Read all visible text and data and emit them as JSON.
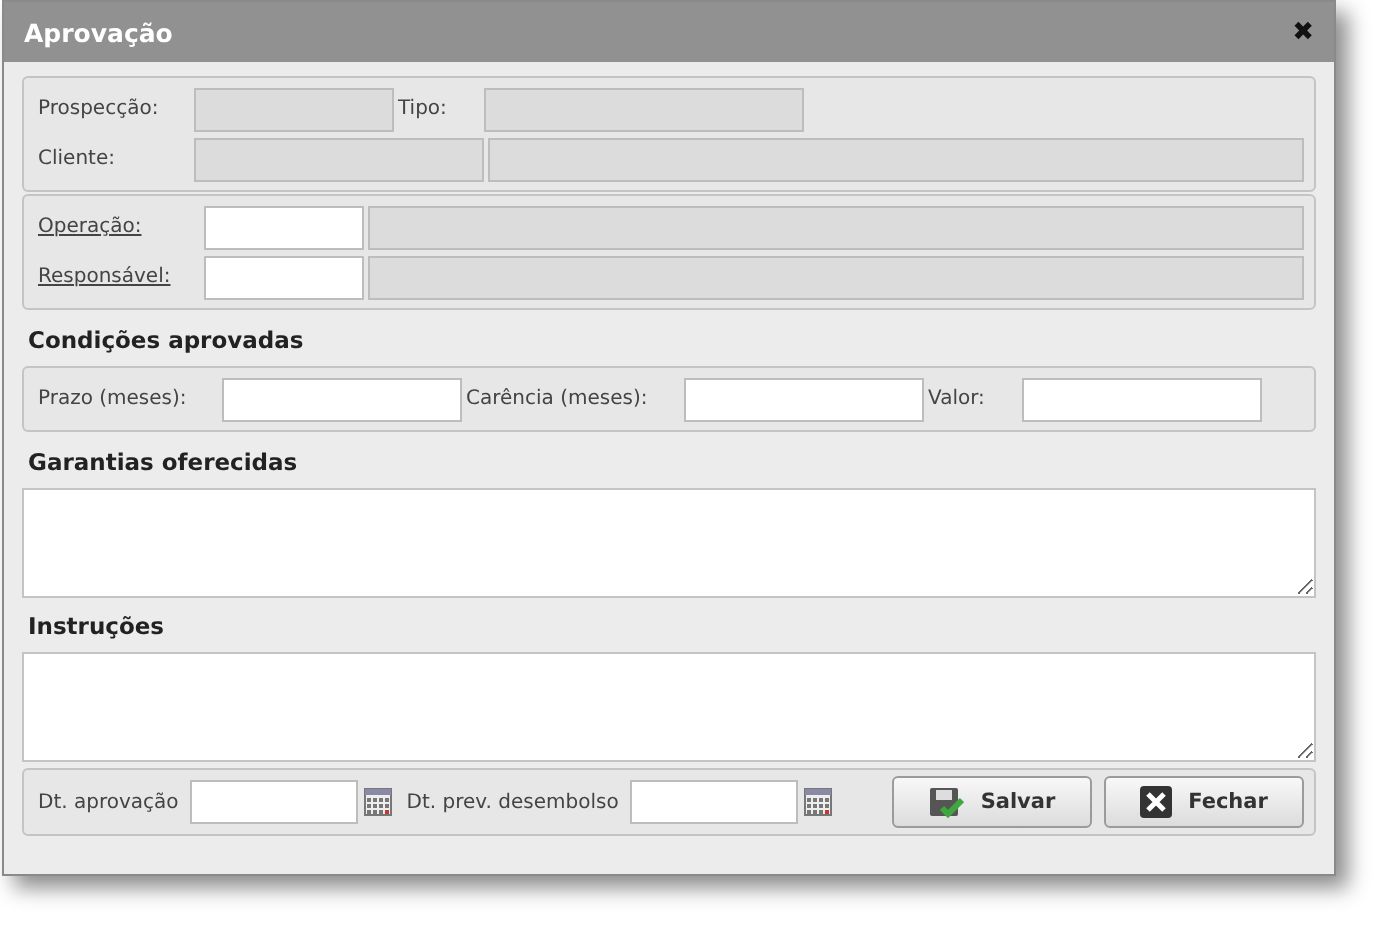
{
  "window": {
    "title": "Aprovação",
    "close": "✖"
  },
  "identification": {
    "rows": [
      {
        "items": [
          {
            "kind": "label",
            "text": "Prospecção:",
            "underlined": false
          },
          {
            "kind": "field",
            "readonly": true
          },
          {
            "kind": "label",
            "text": "Tipo:",
            "underlined": false
          },
          {
            "kind": "field",
            "readonly": true
          }
        ]
      },
      {
        "items": [
          {
            "kind": "label",
            "text": "Cliente:",
            "underlined": false
          },
          {
            "kind": "field",
            "readonly": true
          },
          {
            "kind": "field",
            "readonly": true
          }
        ]
      }
    ]
  },
  "assignment": {
    "rows": [
      {
        "items": [
          {
            "kind": "label",
            "text": "Operação:",
            "underlined": true
          },
          {
            "kind": "field",
            "readonly": false
          },
          {
            "kind": "field",
            "readonly": true
          }
        ]
      },
      {
        "items": [
          {
            "kind": "label",
            "text": "Responsável:",
            "underlined": true
          },
          {
            "kind": "field",
            "readonly": false
          },
          {
            "kind": "field",
            "readonly": true
          }
        ]
      }
    ]
  },
  "conditions": {
    "title": "Condições aprovadas",
    "rows": [
      {
        "items": [
          {
            "kind": "label",
            "text": "Prazo (meses):",
            "underlined": false
          },
          {
            "kind": "field",
            "readonly": false
          },
          {
            "kind": "label",
            "text": "Carência (meses):",
            "underlined": false
          },
          {
            "kind": "field",
            "readonly": false
          },
          {
            "kind": "label",
            "text": "Valor:",
            "underlined": false
          },
          {
            "kind": "field",
            "readonly": false
          }
        ]
      }
    ]
  },
  "guarantees": {
    "title": "Garantias oferecidas"
  },
  "instructions": {
    "title": "Instruções"
  },
  "footer": {
    "dates": [
      {
        "label": "Dt. aprovação"
      },
      {
        "label": "Dt. prev. desembolso"
      }
    ],
    "buttons": [
      {
        "kind": "save",
        "label": "Salvar"
      },
      {
        "kind": "close",
        "label": "Fechar"
      }
    ]
  }
}
